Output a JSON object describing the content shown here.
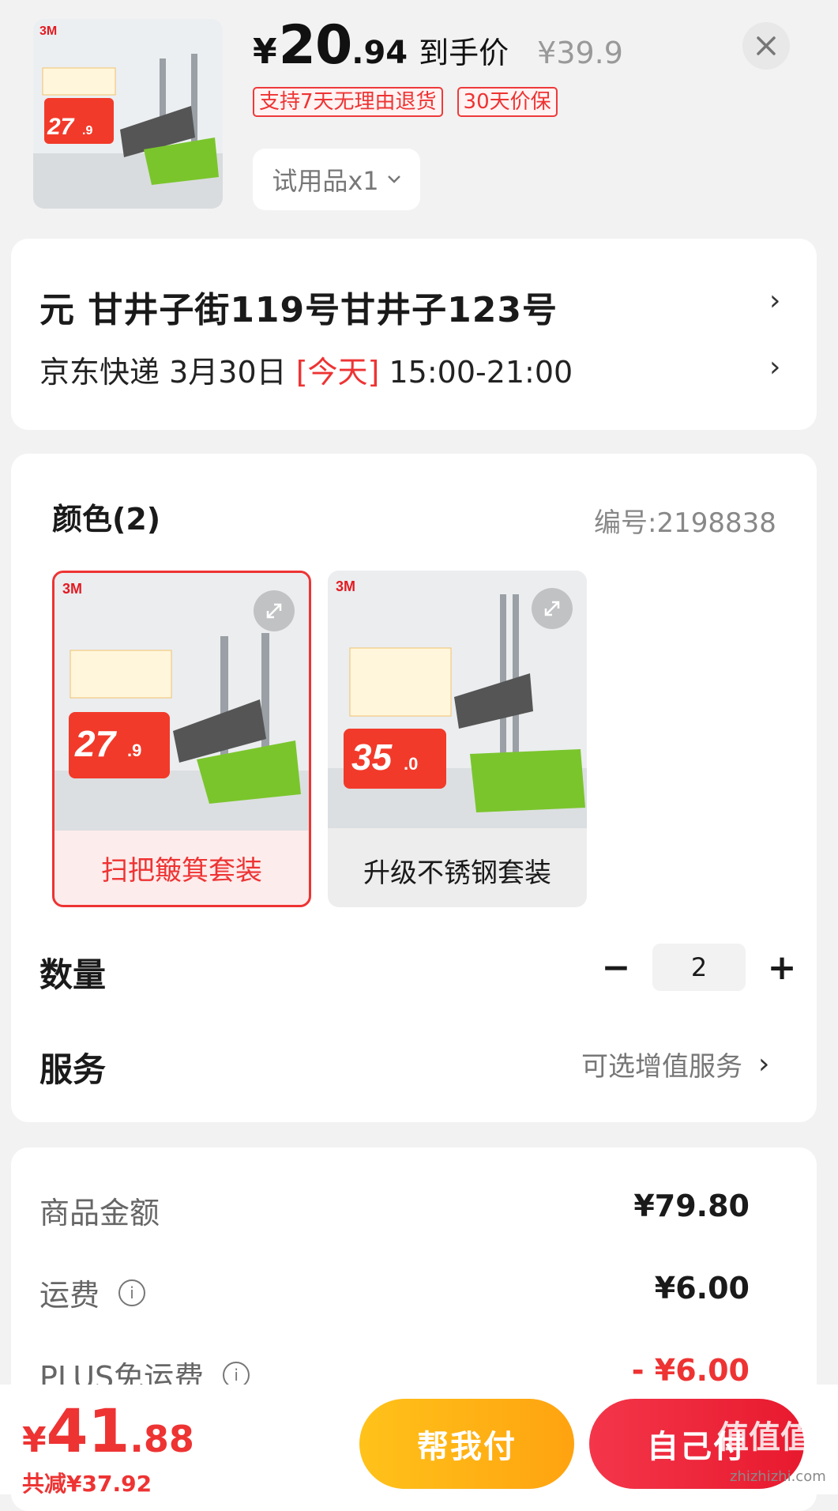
{
  "header": {
    "currency": "¥",
    "price_int": "20",
    "price_dec": ".94",
    "price_label": "到手价",
    "original_price": "¥39.9",
    "tags": [
      "支持7天无理由退货",
      "30天价保"
    ],
    "spec_selector": "试用品x1",
    "close_icon": "close-icon",
    "thumb_brand": "3M",
    "thumb_price": "27",
    "thumb_price_dec": ".9"
  },
  "address": {
    "line": "元  甘井子街119号甘井子123号",
    "carrier": "京东快递",
    "date": "3月30日",
    "today": "[今天]",
    "window": "15:00-21:00"
  },
  "spec": {
    "color_title": "颜色(2)",
    "sku": "编号:2198838",
    "options": [
      {
        "name": "扫把簸箕套装",
        "brand": "3M",
        "promo_price": "27",
        "promo_dec": ".9",
        "selected": true
      },
      {
        "name": "升级不锈钢套装",
        "brand": "3M",
        "promo_price": "35",
        "promo_dec": ".0",
        "selected": false
      }
    ],
    "quantity_label": "数量",
    "quantity": "2",
    "minus": "−",
    "plus": "+",
    "service_label": "服务",
    "service_value": "可选增值服务"
  },
  "summary": {
    "rows": [
      {
        "label": "商品金额",
        "value": "¥79.80"
      },
      {
        "label": "运费",
        "value": "¥6.00"
      },
      {
        "label": "PLUS免运费",
        "value": "- ¥6.00"
      }
    ]
  },
  "footer": {
    "currency": "¥",
    "total_int": "41",
    "total_dec": ".88",
    "saved": "共减¥37.92",
    "help_pay": "帮我付",
    "self_pay": "自己付",
    "watermark": "值值值",
    "watermark_url": "zhizhizhi.com"
  },
  "colors": {
    "accent": "#e8192e",
    "yellow": "#ffb21a",
    "promo_green": "#7ac52c"
  }
}
